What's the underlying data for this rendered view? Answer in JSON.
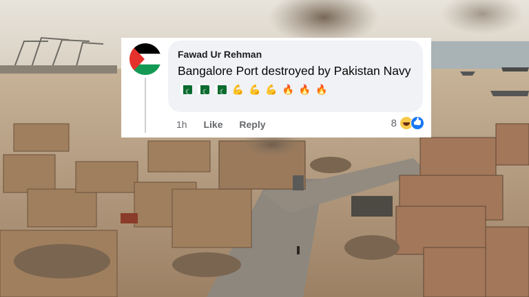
{
  "comment": {
    "author": "Fawad Ur Rehman",
    "text": "Bangalore Port destroyed by Pakistan Navy",
    "emojis": [
      {
        "icon": "pakistan-flag-emoji"
      },
      {
        "icon": "pakistan-flag-emoji"
      },
      {
        "icon": "pakistan-flag-emoji"
      },
      {
        "icon": "flexed-biceps-emoji",
        "glyph": "💪"
      },
      {
        "icon": "flexed-biceps-emoji",
        "glyph": "💪"
      },
      {
        "icon": "flexed-biceps-emoji",
        "glyph": "💪"
      },
      {
        "icon": "fire-emoji",
        "glyph": "🔥"
      },
      {
        "icon": "fire-emoji",
        "glyph": "🔥"
      },
      {
        "icon": "fire-emoji",
        "glyph": "🔥"
      }
    ],
    "time": "1h",
    "like_label": "Like",
    "reply_label": "Reply",
    "reaction_count": "8",
    "reaction_icons": [
      "haha-reaction-icon",
      "like-reaction-icon"
    ]
  },
  "colors": {
    "bubble": "#f0f2f5",
    "action_text": "#65676b",
    "like_blue": "#1877f2",
    "flag_green": "#0a6b2e"
  }
}
